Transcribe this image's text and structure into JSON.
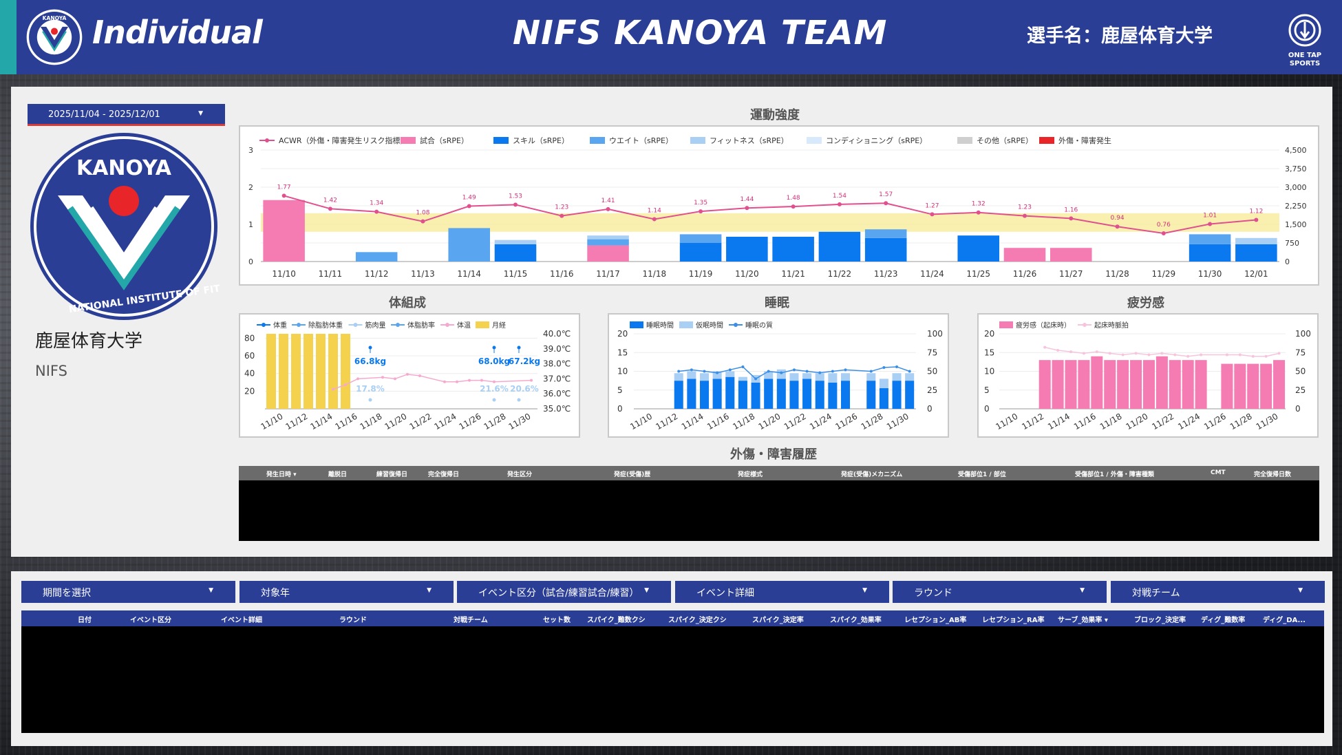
{
  "header": {
    "title": "Individual",
    "team": "NIFS KANOYA TEAM",
    "player_label": "選手名：鹿屋体育大学",
    "brand_line1": "ONE TAP",
    "brand_line2": "SPORTS"
  },
  "logo": {
    "top_text": "KANOYA",
    "ring_text": "NATIONAL INSTITUTE OF FITNESS AND SPORTS"
  },
  "sidebar": {
    "date_range": "2025/11/04 - 2025/12/01",
    "team_jp": "鹿屋体育大学",
    "team_en": "NIFS"
  },
  "sections": {
    "intensity": "運動強度",
    "body": "体組成",
    "sleep": "睡眠",
    "fatigue": "疲労感",
    "injury": "外傷・障害履歴"
  },
  "colors": {
    "header": "#2b3e96",
    "accent": "#23a7a8",
    "pink": "#f47cb3",
    "blue": "#0a78ee",
    "yellow": "#f5d24e"
  },
  "chart_data": [
    {
      "id": "intensity",
      "type": "bar",
      "title": "運動強度",
      "legend": [
        "ACWR（外傷・障害発生リスク指標）",
        "試合（sRPE）",
        "スキル（sRPE）",
        "ウエイト（sRPE）",
        "フィットネス（sRPE）",
        "コンディショニング（sRPE）",
        "その他（sRPE）",
        "外傷・障害発生"
      ],
      "categories": [
        "11/10",
        "11/11",
        "11/12",
        "11/13",
        "11/14",
        "11/15",
        "11/16",
        "11/17",
        "11/18",
        "11/19",
        "11/20",
        "11/21",
        "11/22",
        "11/23",
        "11/24",
        "11/25",
        "11/26",
        "11/27",
        "11/28",
        "11/29",
        "11/30",
        "12/01"
      ],
      "y_left": {
        "ticks": [
          "0",
          "1",
          "2",
          "3"
        ],
        "range": [
          0,
          3
        ]
      },
      "y_right": {
        "ticks": [
          "0",
          "750",
          "1,500",
          "2,250",
          "3,000",
          "3,750",
          "4,500"
        ],
        "range": [
          0,
          4500
        ]
      },
      "acwr_band": [
        0.8,
        1.3
      ],
      "acwr": [
        1.77,
        1.42,
        1.34,
        1.08,
        1.49,
        1.53,
        1.23,
        1.41,
        1.14,
        1.35,
        1.44,
        1.48,
        1.54,
        1.57,
        1.27,
        1.32,
        1.23,
        1.16,
        0.94,
        0.76,
        1.01,
        1.12
      ],
      "acwr_labels": [
        "1.77",
        "1.42",
        "1.34",
        "1.08",
        "1.49",
        "1.53",
        "1.23",
        "1.41",
        "1.14",
        "1.35",
        "1.44",
        "1.48",
        "1.54",
        "1.57",
        "1.27",
        "1.32",
        "1.23",
        "1.16",
        "0.94",
        "0.76",
        "1.01",
        "1.12"
      ],
      "series": [
        {
          "name": "試合（sRPE）",
          "color": "#f47cb3",
          "values": [
            2480,
            0,
            0,
            0,
            0,
            0,
            0,
            650,
            0,
            0,
            0,
            0,
            0,
            0,
            0,
            0,
            550,
            550,
            0,
            0,
            0,
            0
          ]
        },
        {
          "name": "スキル（sRPE）",
          "color": "#0a78ee",
          "values": [
            0,
            0,
            0,
            0,
            0,
            700,
            0,
            0,
            0,
            750,
            1000,
            1000,
            1200,
            950,
            0,
            1050,
            0,
            0,
            0,
            0,
            700,
            700
          ]
        },
        {
          "name": "ウエイト（sRPE）",
          "color": "#5aa5ef",
          "values": [
            0,
            0,
            380,
            0,
            1350,
            0,
            0,
            250,
            0,
            350,
            0,
            0,
            0,
            350,
            0,
            0,
            0,
            0,
            0,
            0,
            400,
            0
          ]
        },
        {
          "name": "フィットネス（sRPE）",
          "color": "#a9cff5",
          "values": [
            0,
            0,
            0,
            0,
            0,
            170,
            0,
            150,
            0,
            0,
            0,
            0,
            0,
            0,
            0,
            0,
            0,
            0,
            0,
            0,
            0,
            250
          ]
        }
      ]
    },
    {
      "id": "body",
      "type": "bar",
      "title": "体組成",
      "legend": [
        "体重",
        "除脂肪体重",
        "筋肉量",
        "体脂肪率",
        "体温",
        "月経"
      ],
      "x_ticks": [
        "11/10",
        "11/12",
        "11/14",
        "11/16",
        "11/18",
        "11/20",
        "11/22",
        "11/24",
        "11/26",
        "11/28",
        "11/30"
      ],
      "y_left": {
        "ticks": [
          "20",
          "40",
          "60",
          "80"
        ],
        "range": [
          0,
          85
        ]
      },
      "y_right": {
        "ticks": [
          "35.0℃",
          "36.0℃",
          "37.0℃",
          "38.0℃",
          "39.0℃",
          "40.0℃"
        ],
        "range": [
          35,
          40
        ]
      },
      "menstruation_days": [
        "11/10",
        "11/11",
        "11/12",
        "11/13",
        "11/14",
        "11/15",
        "11/16"
      ],
      "weight_labels": [
        "66.8kg",
        "68.0kg",
        "67.2kg"
      ],
      "body_fat_labels": [
        "17.8%",
        "21.6%",
        "20.6%"
      ],
      "temperature": [
        null,
        null,
        null,
        null,
        null,
        36.3,
        36.6,
        37.0,
        null,
        37.1,
        37.0,
        37.3,
        37.2,
        null,
        36.8,
        36.8,
        36.9,
        36.9,
        36.8,
        null,
        null,
        36.9,
        null
      ]
    },
    {
      "id": "sleep",
      "type": "bar",
      "title": "睡眠",
      "legend": [
        "睡眠時間",
        "仮眠時間",
        "睡眠の質"
      ],
      "x_ticks": [
        "11/10",
        "11/12",
        "11/14",
        "11/16",
        "11/18",
        "11/20",
        "11/22",
        "11/24",
        "11/26",
        "11/28",
        "11/30"
      ],
      "y_left": {
        "ticks": [
          "0",
          "5",
          "10",
          "15",
          "20"
        ],
        "range": [
          0,
          20
        ]
      },
      "y_right": {
        "ticks": [
          "0",
          "25",
          "50",
          "75",
          "100"
        ],
        "range": [
          0,
          100
        ]
      },
      "sleep": [
        null,
        null,
        null,
        7.5,
        8,
        7.5,
        8,
        8.5,
        7.5,
        7,
        8,
        8,
        7.5,
        8,
        7.5,
        7,
        7.5,
        null,
        7.5,
        5.5,
        7.5,
        7.5
      ],
      "nap": [
        null,
        null,
        null,
        2,
        2,
        2,
        2,
        1.5,
        1,
        2,
        2,
        2.5,
        2,
        1.5,
        2,
        2.5,
        2,
        null,
        2,
        2.5,
        2,
        2
      ],
      "quality": [
        null,
        null,
        null,
        50,
        52,
        50,
        48,
        52,
        56,
        40,
        50,
        48,
        52,
        50,
        48,
        50,
        52,
        null,
        50,
        55,
        56,
        50
      ]
    },
    {
      "id": "fatigue",
      "type": "bar",
      "title": "疲労感",
      "legend": [
        "疲労感（起床時）",
        "起床時脈拍"
      ],
      "x_ticks": [
        "11/10",
        "11/12",
        "11/14",
        "11/16",
        "11/18",
        "11/20",
        "11/22",
        "11/24",
        "11/26",
        "11/28",
        "11/30"
      ],
      "y_left": {
        "ticks": [
          "0",
          "5",
          "10",
          "15",
          "20"
        ],
        "range": [
          0,
          20
        ]
      },
      "y_right": {
        "ticks": [
          "0",
          "25",
          "50",
          "75",
          "100"
        ],
        "range": [
          0,
          100
        ]
      },
      "fatigue": [
        null,
        null,
        null,
        13,
        13,
        13,
        13,
        14,
        13,
        13,
        13,
        13,
        14,
        13,
        13,
        13,
        null,
        12,
        12,
        12,
        12,
        13
      ],
      "pulse": [
        null,
        null,
        null,
        82,
        78,
        76,
        74,
        76,
        74,
        72,
        74,
        72,
        74,
        72,
        70,
        72,
        null,
        72,
        72,
        70,
        70,
        74
      ]
    }
  ],
  "injury_table": {
    "headers": [
      "発生日時 ▾",
      "離脱日",
      "練習復帰日",
      "完全復帰日",
      "発生区分",
      "発症(受傷)歴",
      "発症様式",
      "発症(受傷)メカニズム",
      "受傷部位1 / 部位",
      "受傷部位1 / 外傷・障害種類",
      "CMT",
      "完全復帰日数"
    ]
  },
  "filters": [
    "期間を選択",
    "対象年",
    "イベント区分（試合/練習試合/練習）",
    "イベント詳細",
    "ラウンド",
    "対戦チーム"
  ],
  "match_table": {
    "headers": [
      "日付",
      "イベント区分",
      "イベント詳細",
      "ラウンド",
      "対戦チーム",
      "セット数",
      "スパイク_難数クシ",
      "スパイク_決定クシ",
      "スパイク_決定率",
      "スパイク_効果率",
      "レセプション_AB率",
      "レセプション_RA率",
      "サーブ_効果率 ▾",
      "ブロック_決定率",
      "ディグ_難数率",
      "ディグ_DA..."
    ]
  }
}
